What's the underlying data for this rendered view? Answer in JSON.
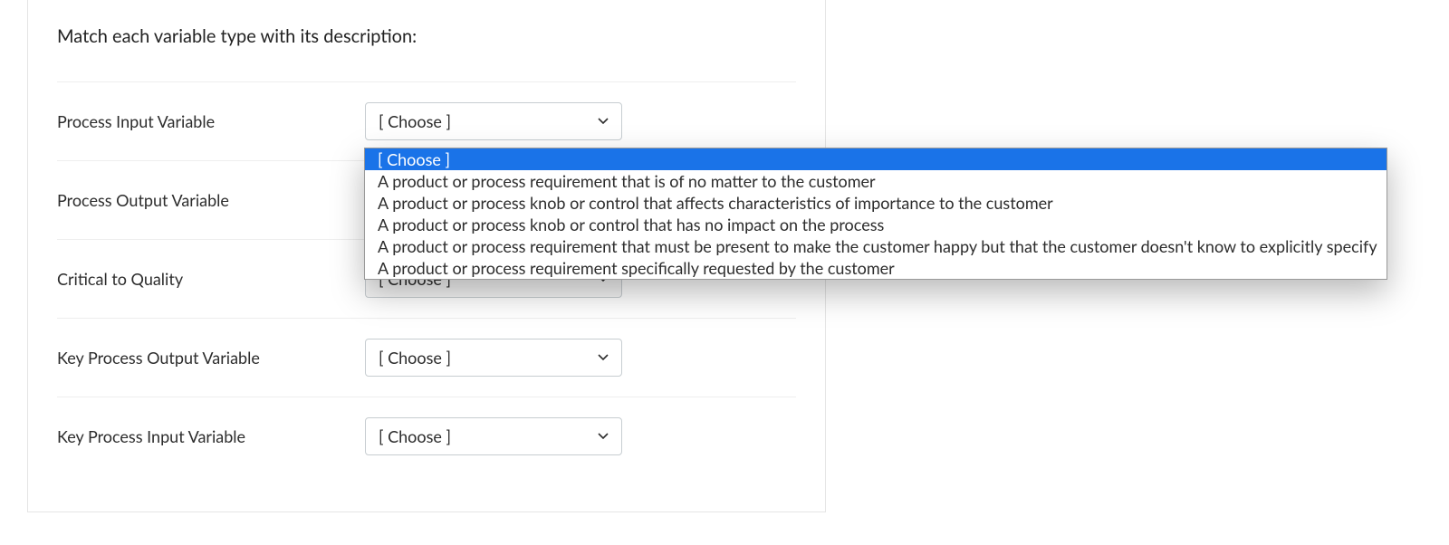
{
  "prompt": "Match each variable type with its description:",
  "choose_placeholder": "[ Choose ]",
  "rows": [
    {
      "label": "Process Input Variable"
    },
    {
      "label": "Process Output Variable"
    },
    {
      "label": "Critical to Quality"
    },
    {
      "label": "Key Process Output Variable"
    },
    {
      "label": "Key Process Input Variable"
    }
  ],
  "dropdown_options": [
    "[ Choose ]",
    "A product or process requirement that is of no matter to the customer",
    "A product or process knob or control that affects characteristics of importance to the customer",
    "A product or process knob or control that has no impact on the process",
    "A product or process requirement that must be present to make the customer happy but that the customer doesn't know to explicitly specify",
    "A product or process requirement specifically requested by the customer"
  ]
}
